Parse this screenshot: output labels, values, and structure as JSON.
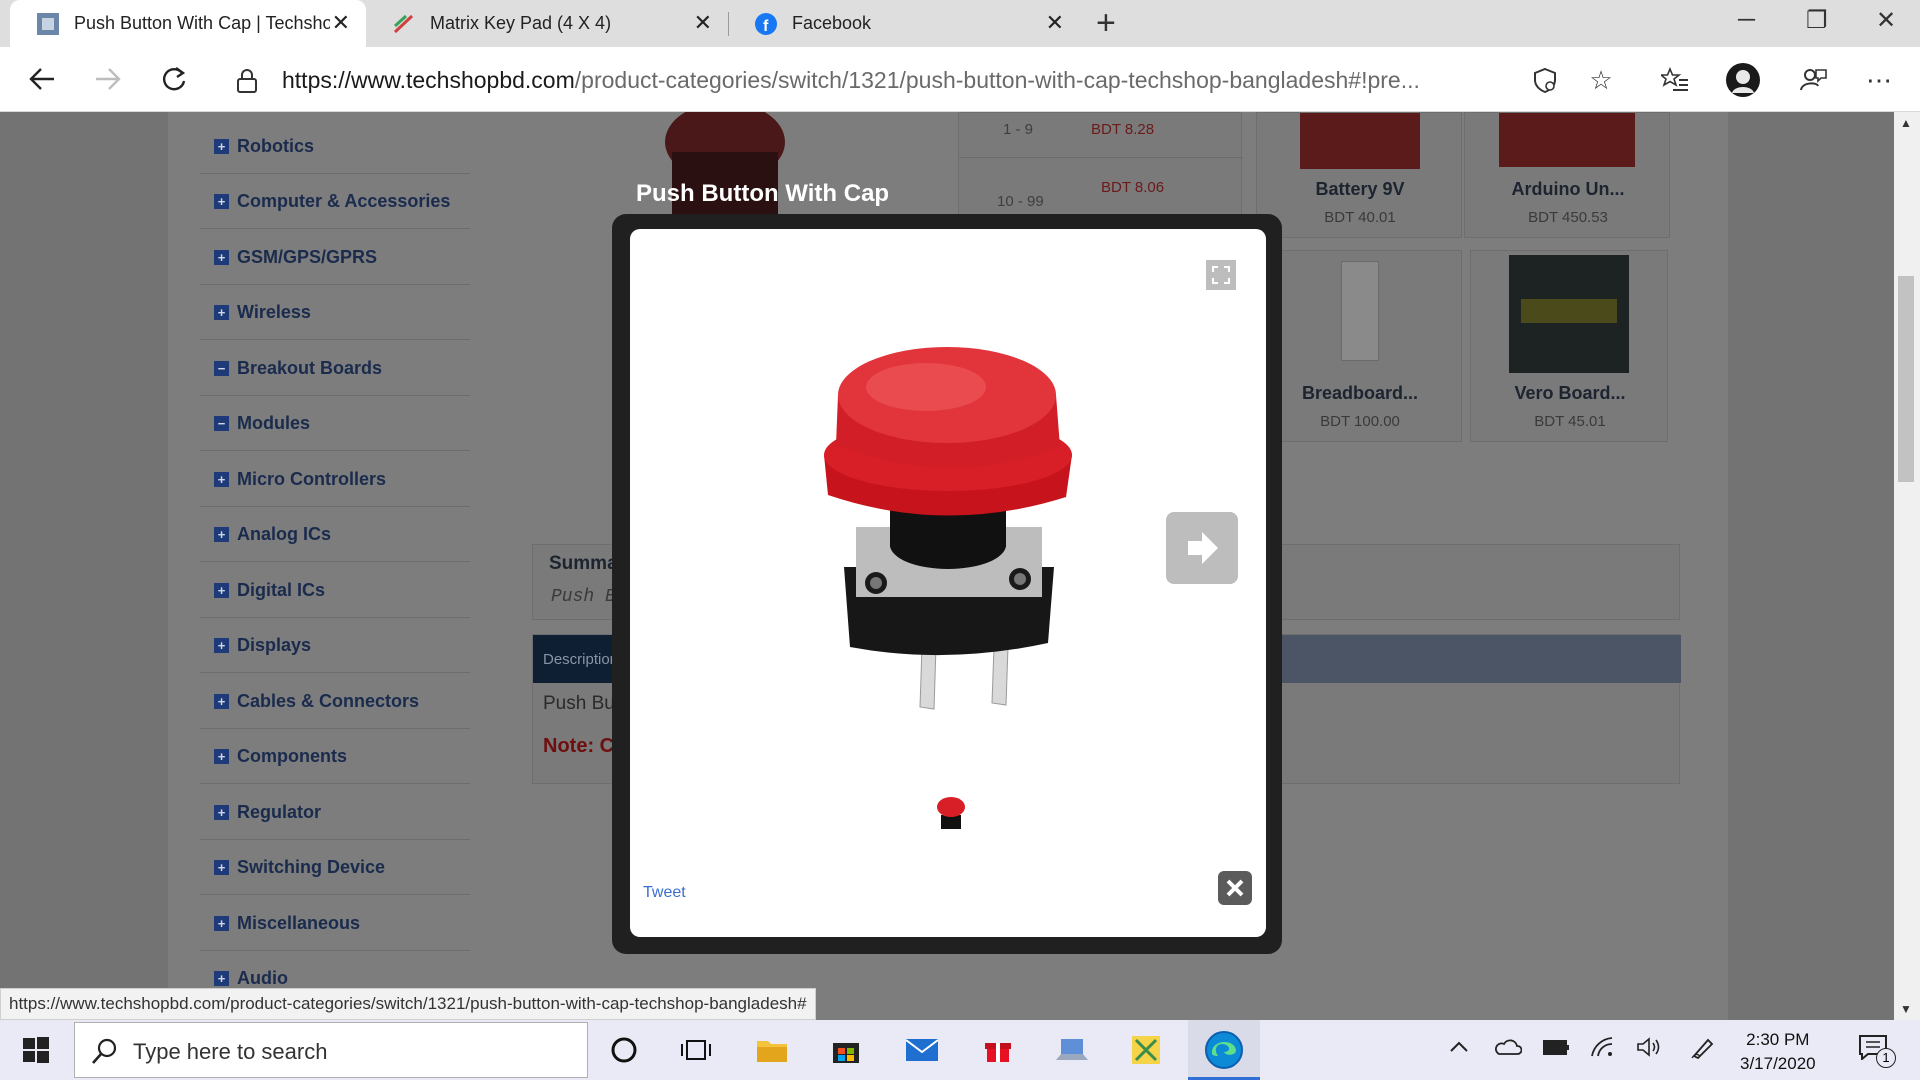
{
  "browser": {
    "tabs": [
      {
        "title": "Push Button With Cap | Techsho",
        "icon": "techshop-favicon",
        "active": true
      },
      {
        "title": "Matrix Key Pad (4 X 4)",
        "icon": "matrix-favicon",
        "active": false
      },
      {
        "title": "Facebook",
        "icon": "facebook-icon",
        "active": false
      }
    ],
    "url_host": "https://www.techshopbd.com",
    "url_path": "/product-categories/switch/1321/push-button-with-cap-techshop-bangladesh#!pre...",
    "status_url": "https://www.techshopbd.com/product-categories/switch/1321/push-button-with-cap-techshop-bangladesh#"
  },
  "sidebar": {
    "items": [
      {
        "label": "Robotics",
        "sign": "+"
      },
      {
        "label": "Computer & Accessories",
        "sign": "+"
      },
      {
        "label": "GSM/GPS/GPRS",
        "sign": "+"
      },
      {
        "label": "Wireless",
        "sign": "+"
      },
      {
        "label": "Breakout Boards",
        "sign": "−"
      },
      {
        "label": "Modules",
        "sign": "−"
      },
      {
        "label": "Micro Controllers",
        "sign": "+"
      },
      {
        "label": "Analog ICs",
        "sign": "+"
      },
      {
        "label": "Digital ICs",
        "sign": "+"
      },
      {
        "label": "Displays",
        "sign": "+"
      },
      {
        "label": "Cables & Connectors",
        "sign": "+"
      },
      {
        "label": "Components",
        "sign": "+"
      },
      {
        "label": "Regulator",
        "sign": "+"
      },
      {
        "label": "Switching Device",
        "sign": "+"
      },
      {
        "label": "Miscellaneous",
        "sign": "+"
      },
      {
        "label": "Audio",
        "sign": "+"
      }
    ]
  },
  "pricing": {
    "rows": [
      {
        "qty": "1 - 9",
        "price": "BDT 8.28"
      },
      {
        "qty": "10 - 99",
        "price": "BDT 8.06"
      }
    ]
  },
  "related": [
    {
      "name": "Battery 9V",
      "price": "BDT 40.01"
    },
    {
      "name": "Arduino Un...",
      "price": "BDT 450.53"
    },
    {
      "name": "Breadboard...",
      "price": "BDT 100.00"
    },
    {
      "name": "Vero Board...",
      "price": "BDT 45.01"
    }
  ],
  "product": {
    "summary_heading": "Summar",
    "summary_text": "Push B",
    "description_tab": "Description",
    "description_text": "Push But",
    "note_text": "Note: C"
  },
  "modal": {
    "title": "Push Button With Cap",
    "tweet_label": "Tweet"
  },
  "taskbar": {
    "search_placeholder": "Type here to search",
    "time": "2:30 PM",
    "date": "3/17/2020",
    "notification_count": "1"
  }
}
